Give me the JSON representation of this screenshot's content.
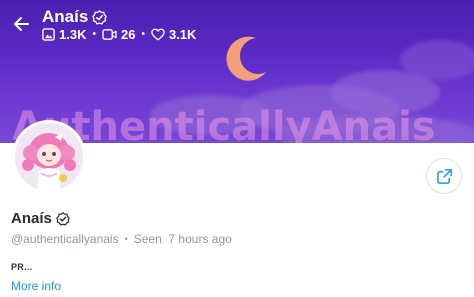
{
  "header": {
    "name": "Anaís",
    "stats": [
      {
        "icon": "image-icon",
        "value": "1.3K"
      },
      {
        "icon": "video-icon",
        "value": "26"
      },
      {
        "icon": "heart-icon",
        "value": "3.1K"
      }
    ]
  },
  "banner": {
    "watermark": "AuthenticallyAnais"
  },
  "profile": {
    "name": "Anaís",
    "handle": "@authenticallyanais",
    "last_seen": "Seen  7 hours ago",
    "bio": "PR...",
    "more_info": "More info"
  },
  "colors": {
    "banner": "#5a2ac4",
    "link": "#1a9ae0",
    "muted": "#8a96a3"
  }
}
